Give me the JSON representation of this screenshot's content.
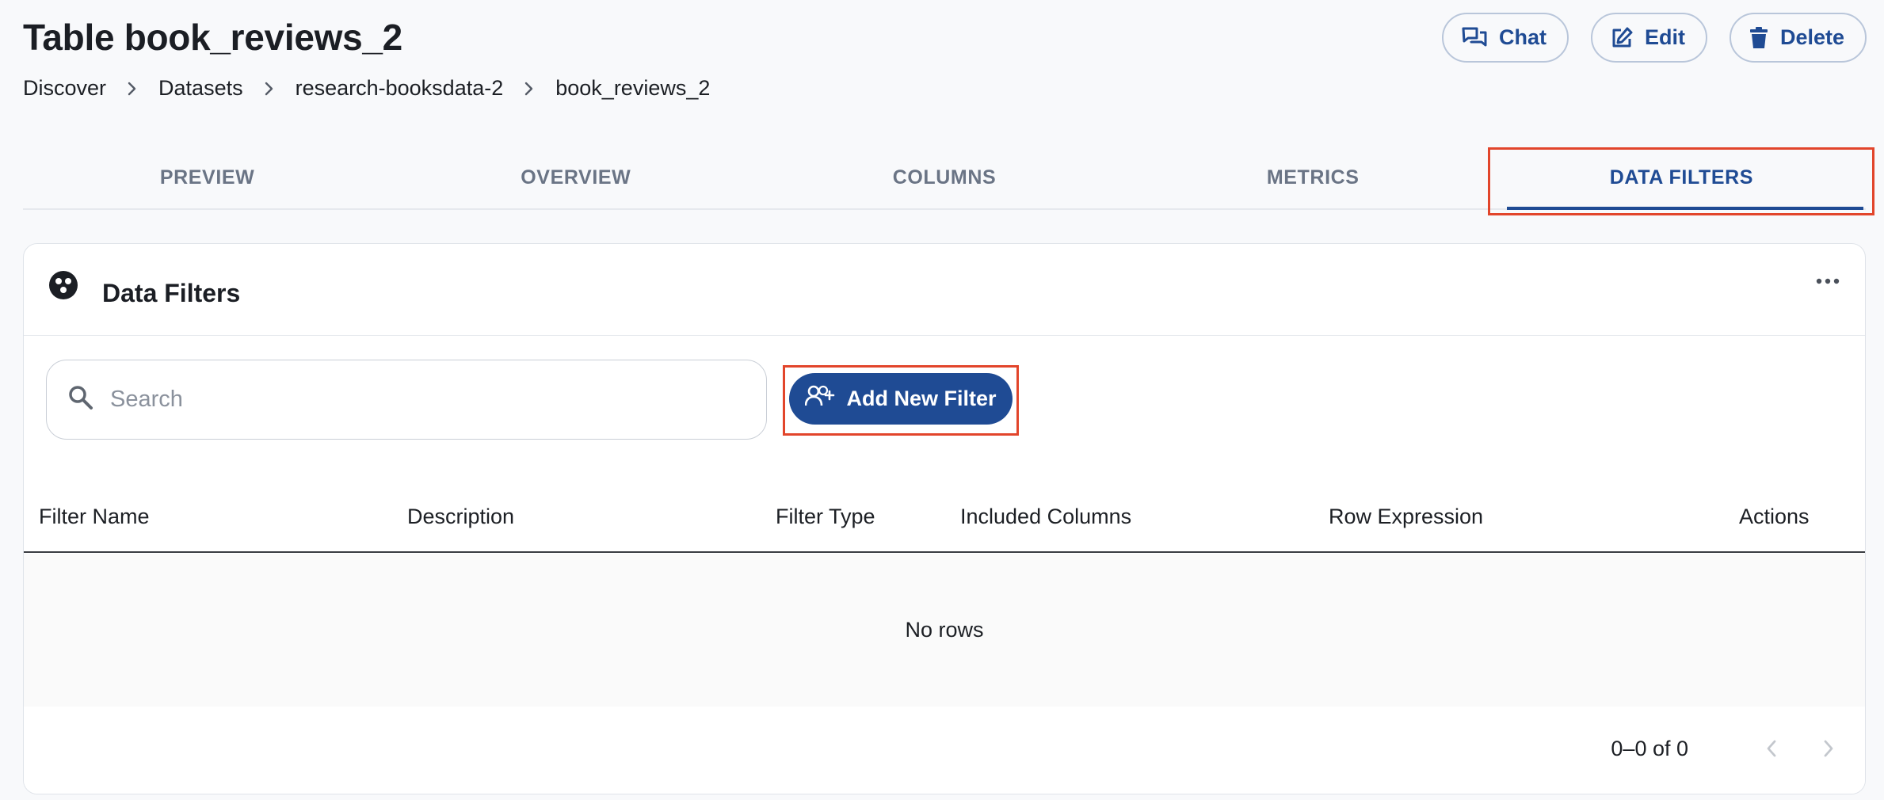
{
  "header": {
    "title": "Table book_reviews_2",
    "breadcrumb": [
      "Discover",
      "Datasets",
      "research-booksdata-2",
      "book_reviews_2"
    ],
    "actions": {
      "chat": "Chat",
      "edit": "Edit",
      "delete": "Delete"
    }
  },
  "tabs": [
    {
      "label": "PREVIEW",
      "active": false
    },
    {
      "label": "OVERVIEW",
      "active": false
    },
    {
      "label": "COLUMNS",
      "active": false
    },
    {
      "label": "METRICS",
      "active": false
    },
    {
      "label": "DATA FILTERS",
      "active": true
    }
  ],
  "card": {
    "title": "Data Filters",
    "search_placeholder": "Search",
    "add_button": "Add New Filter",
    "columns": [
      "Filter Name",
      "Description",
      "Filter Type",
      "Included Columns",
      "Row Expression",
      "Actions"
    ],
    "empty_message": "No rows",
    "pagination": "0–0 of 0"
  },
  "colors": {
    "accent": "#1f4b94",
    "highlight": "#e2452b"
  }
}
